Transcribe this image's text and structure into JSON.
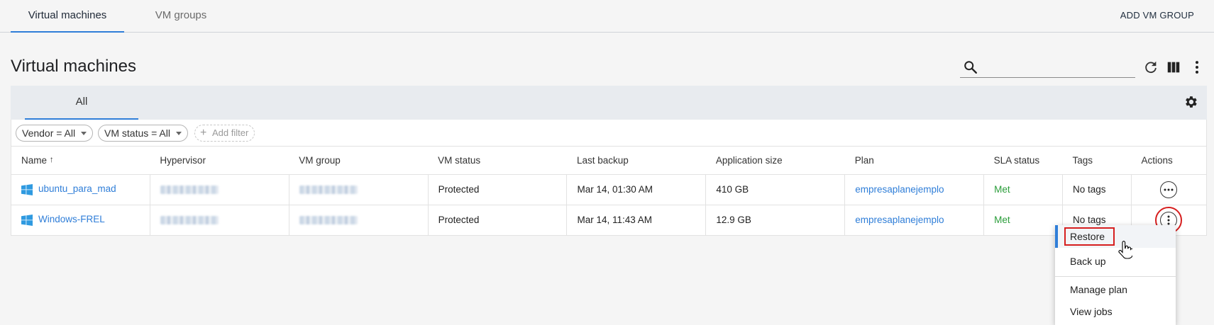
{
  "top_tabs": [
    {
      "label": "Virtual machines",
      "active": true
    },
    {
      "label": "VM groups",
      "active": false
    }
  ],
  "add_vm_group_label": "ADD VM GROUP",
  "page_title": "Virtual machines",
  "search": {
    "placeholder": "",
    "value": ""
  },
  "toolbar_icons": [
    "refresh-icon",
    "columns-icon",
    "more-vertical-icon"
  ],
  "view_tab": "All",
  "filters": [
    {
      "label": "Vendor = All"
    },
    {
      "label": "VM status = All"
    }
  ],
  "add_filter_label": "Add filter",
  "columns": [
    "Name",
    "Hypervisor",
    "VM group",
    "VM status",
    "Last backup",
    "Application size",
    "Plan",
    "SLA status",
    "Tags",
    "Actions"
  ],
  "rows": [
    {
      "name": "ubuntu_para_mad",
      "vm_status": "Protected",
      "last_backup": "Mar 14, 01:30 AM",
      "app_size": "410 GB",
      "plan": "empresaplanejemplo",
      "sla": "Met",
      "tags": "No tags"
    },
    {
      "name": "Windows-FREL",
      "vm_status": "Protected",
      "last_backup": "Mar 14, 11:43 AM",
      "app_size": "12.9 GB",
      "plan": "empresaplanejemplo",
      "sla": "Met",
      "tags": "No tags"
    }
  ],
  "menu": [
    "Restore",
    "Back up",
    "Manage plan",
    "View jobs"
  ],
  "colors": {
    "accent": "#2f7ed8",
    "met": "#2a9d3a",
    "highlight": "#d61f1f"
  }
}
